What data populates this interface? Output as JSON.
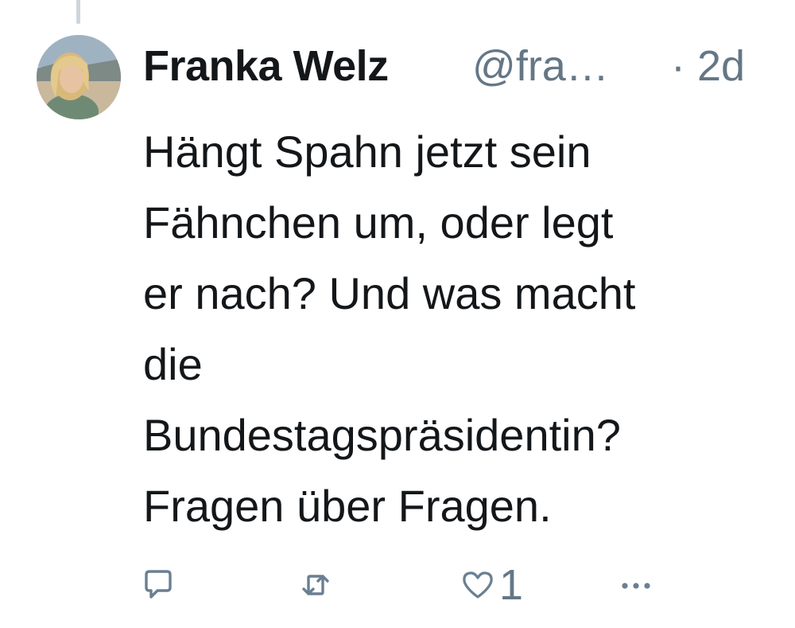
{
  "tweet": {
    "author_name": "Franka Welz",
    "author_handle": "@fra…",
    "timestamp": "· 2d",
    "text_lines": [
      "Hängt Spahn jetzt sein",
      "Fähnchen um, oder legt",
      "er nach? Und was macht",
      "die",
      "Bundestagspräsidentin?",
      "Fragen über Fragen."
    ],
    "like_count": "1"
  },
  "icons": {
    "reply": "reply-icon",
    "retweet": "retweet-icon",
    "like": "heart-icon",
    "more": "more-icon"
  },
  "colors": {
    "text": "#14171a",
    "secondary": "#657786",
    "icon": "#6a7f92",
    "thread_line": "#cdd5dc"
  }
}
